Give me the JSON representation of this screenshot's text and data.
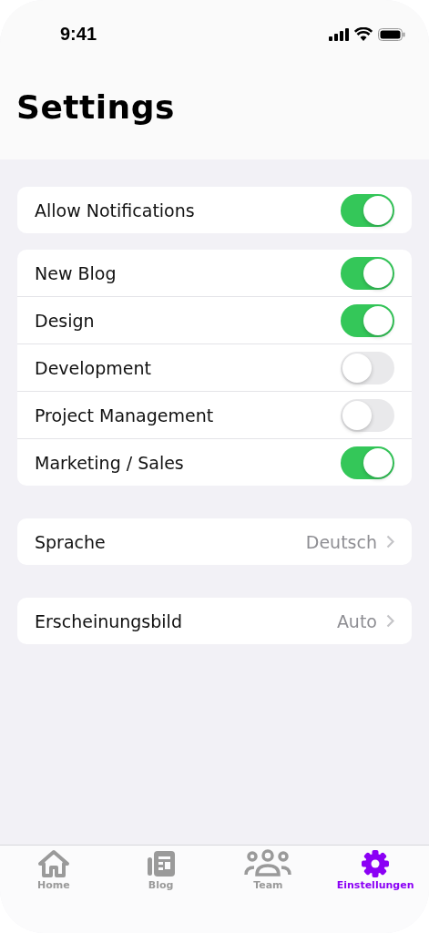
{
  "status_bar": {
    "time": "9:41"
  },
  "title": "Settings",
  "groups": [
    {
      "rows": [
        {
          "kind": "toggle",
          "label": "Allow Notifications",
          "on": true
        }
      ]
    },
    {
      "rows": [
        {
          "kind": "toggle",
          "label": "New Blog",
          "on": true
        },
        {
          "kind": "toggle",
          "label": "Design",
          "on": true
        },
        {
          "kind": "toggle",
          "label": "Development",
          "on": false
        },
        {
          "kind": "toggle",
          "label": "Project Management",
          "on": false
        },
        {
          "kind": "toggle",
          "label": "Marketing / Sales",
          "on": true
        }
      ]
    },
    {
      "rows": [
        {
          "kind": "nav",
          "label": "Sprache",
          "value": "Deutsch"
        }
      ]
    },
    {
      "rows": [
        {
          "kind": "nav",
          "label": "Erscheinungsbild",
          "value": "Auto"
        }
      ]
    }
  ],
  "tabs": [
    {
      "kind": "home",
      "label": "Home",
      "selected": false
    },
    {
      "kind": "blog",
      "label": "Blog",
      "selected": false
    },
    {
      "kind": "team",
      "label": "Team",
      "selected": false
    },
    {
      "kind": "settings",
      "label": "Einstellungen",
      "selected": true
    }
  ]
}
